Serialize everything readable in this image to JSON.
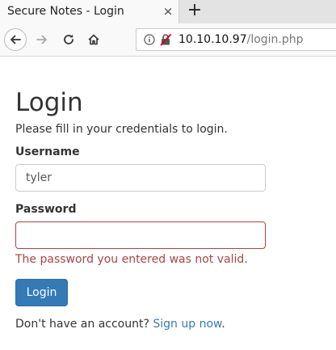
{
  "browser": {
    "tab_title": "Secure Notes - Login",
    "tab_close_symbol": "×",
    "new_tab_symbol": "+",
    "url_host": "10.10.10.97",
    "url_path": "/login.php",
    "icons": {
      "back": "back-arrow-icon",
      "forward": "forward-arrow-icon",
      "reload": "reload-icon",
      "home": "home-icon",
      "info": "info-icon",
      "insecure": "insecure-lock-icon"
    }
  },
  "page": {
    "title": "Login",
    "subtitle": "Please fill in your credentials to login.",
    "username_label": "Username",
    "username_value": "tyler",
    "password_label": "Password",
    "password_value": "",
    "error_message": "The password you entered was not valid.",
    "login_button": "Login",
    "signup_prompt": "Don't have an account?",
    "signup_link": "Sign up now",
    "signup_suffix": "."
  },
  "colors": {
    "primary": "#337ab7",
    "error": "#a94442",
    "text": "#333333"
  }
}
